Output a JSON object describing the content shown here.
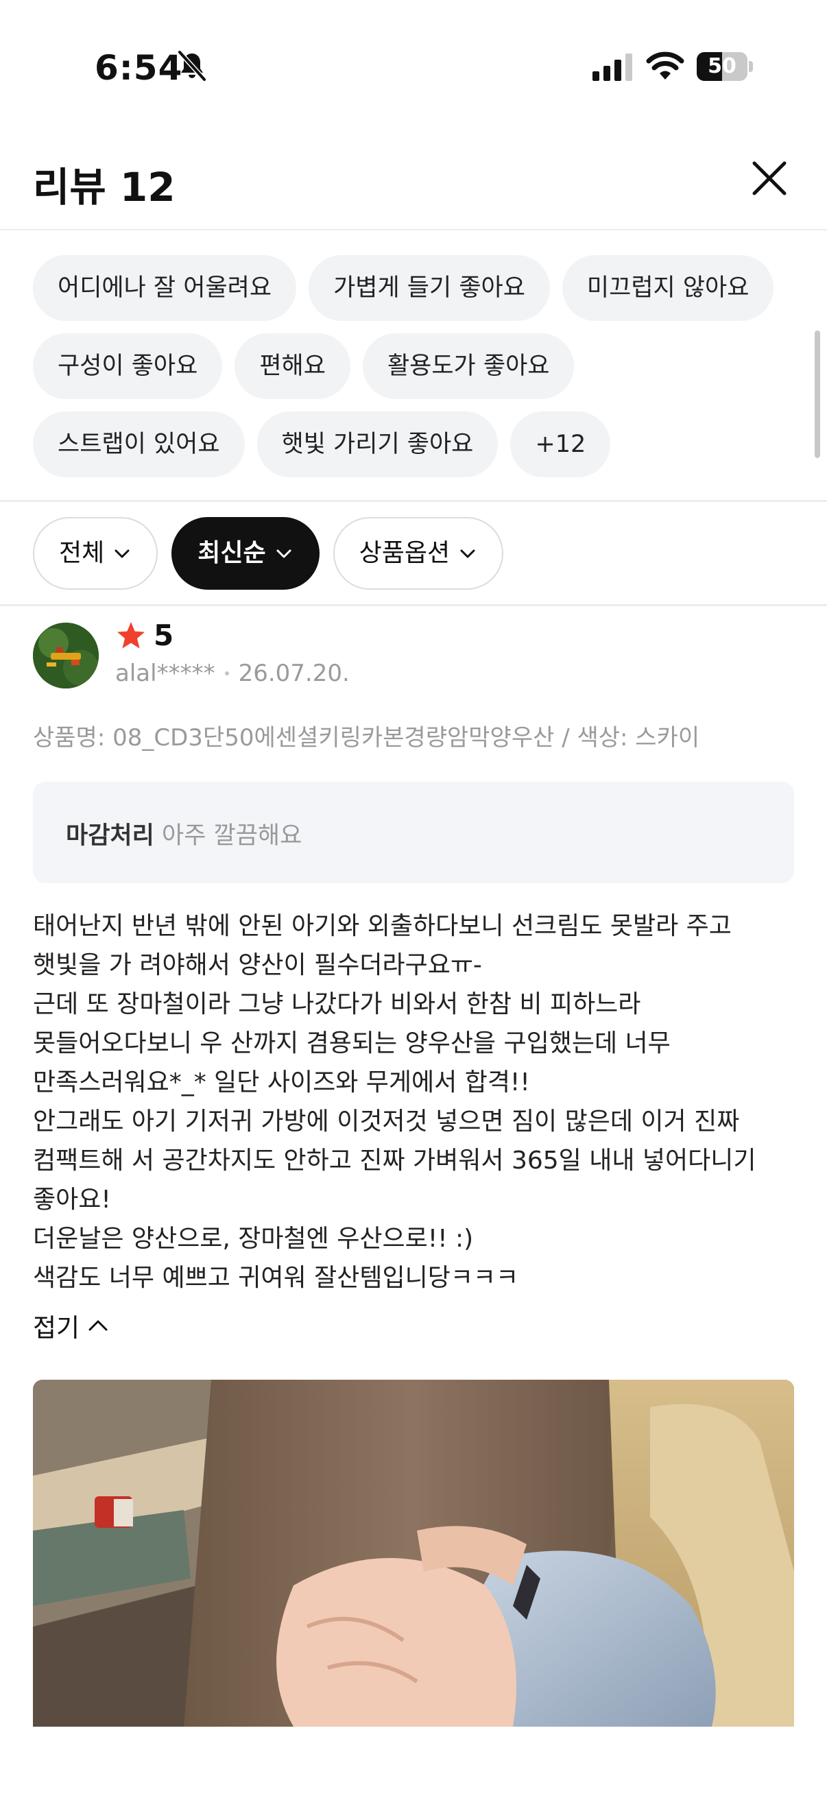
{
  "status_bar": {
    "time": "6:54",
    "battery_level": "50"
  },
  "header": {
    "title": "리뷰 12"
  },
  "keywords": [
    "어디에나 잘 어울려요",
    "가볍게 들기 좋아요",
    "미끄럽지 않아요",
    "구성이 좋아요",
    "편해요",
    "활용도가 좋아요",
    "스트랩이 있어요",
    "햇빛 가리기 좋아요",
    "+12"
  ],
  "filters": {
    "all": "전체",
    "sort": "최신순",
    "options": "상품옵션"
  },
  "review": {
    "rating": "5",
    "user": "alal*****",
    "date": "26.07.20.",
    "option": "상품명: 08_CD3단50에센셜키링카본경량암막양우산 / 색상: 스카이",
    "highlight_label": "마감처리",
    "highlight_value": "아주 깔끔해요",
    "body_lines": [
      "태어난지 반년 밖에 안된 아기와 외출하다보니 선크림도 못발라 주고",
      "햇빛을 가 려야해서 양산이 필수더라구요ㅠ-",
      "근데 또 장마철이라 그냥 나갔다가 비와서 한참 비 피하느라",
      "못들어오다보니 우 산까지 겸용되는 양우산을 구입했는데 너무",
      "만족스러워요*_* 일단 사이즈와 무게에서 합격!!",
      "안그래도 아기 기저귀 가방에 이것저것 넣으면 짐이 많은데 이거 진짜",
      "컴팩트해 서 공간차지도 안하고 진짜 가벼워서 365일 내내 넣어다니기",
      "좋아요!",
      "더운날은 양산으로, 장마철엔 우산으로!! :)",
      "색감도 너무 예쁘고 귀여워 잘산템입니당ㅋㅋㅋ"
    ],
    "fold_label": "접기"
  },
  "colors": {
    "star": "#f0412e",
    "active_filter": "#111111",
    "chip_bg": "#f1f3f5"
  }
}
